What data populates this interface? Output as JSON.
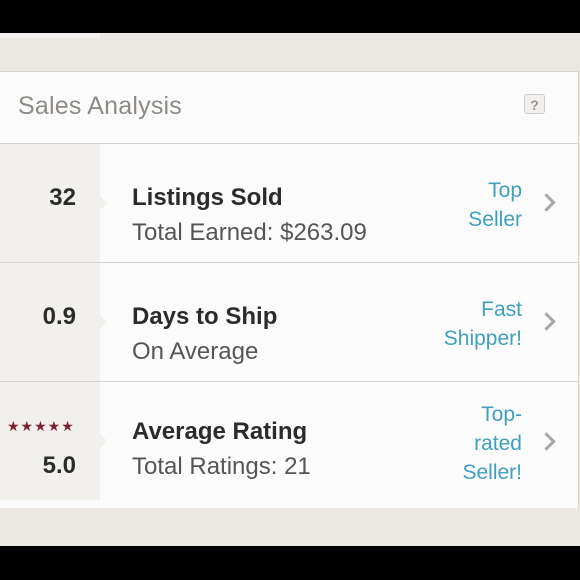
{
  "header": {
    "title": "Sales Analysis",
    "help_label": "?"
  },
  "rows": [
    {
      "stat": "32",
      "title": "Listings Sold",
      "subtitle": "Total Earned: $263.09",
      "badge_lines": [
        "Top",
        "Seller"
      ]
    },
    {
      "stat": "0.9",
      "title": "Days to Ship",
      "subtitle": "On Average",
      "badge_lines": [
        "Fast",
        "Shipper!"
      ]
    },
    {
      "stat": "5.0",
      "stars": "★★★★★",
      "title": "Average Rating",
      "subtitle": "Total Ratings: 21",
      "badge_lines": [
        "Top-",
        "rated",
        "Seller!"
      ]
    }
  ],
  "colors": {
    "accent": "#3f9fc0",
    "star": "#7b2431",
    "panel": "#f2f0ec"
  },
  "icons": {
    "help": "help-icon",
    "chevron": "chevron-right-icon",
    "star": "star-icon"
  }
}
